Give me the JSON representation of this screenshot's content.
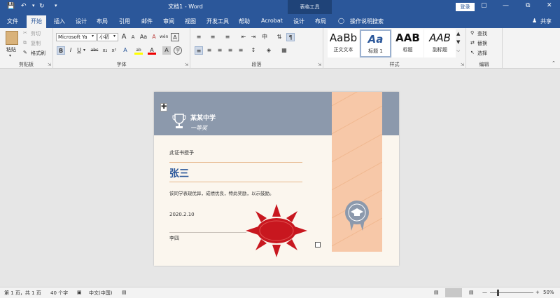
{
  "titlebar": {
    "doc_title": "文档1 - Word",
    "context_tab": "表格工具",
    "login": "登录",
    "quick_access": [
      "save-icon",
      "undo-icon",
      "redo-icon",
      "customize-icon"
    ]
  },
  "tabs": [
    "文件",
    "开始",
    "插入",
    "设计",
    "布局",
    "引用",
    "邮件",
    "审阅",
    "视图",
    "开发工具",
    "帮助",
    "Acrobat",
    "设计",
    "布局"
  ],
  "tell_me": "操作说明搜索",
  "share": "共享",
  "clipboard": {
    "paste": "粘贴",
    "cut": "剪切",
    "copy": "复制",
    "format_painter": "格式刷",
    "label": "剪贴板"
  },
  "font": {
    "name": "Microsoft Ya",
    "size": "小初",
    "label": "字体",
    "aa": "Aa",
    "grow": "A",
    "shrink": "A",
    "clear": "A",
    "wen": "wén",
    "a_box": "A",
    "bold": "B",
    "italic": "I",
    "underline": "U",
    "strike": "abc",
    "sub": "x₂",
    "sup": "x²",
    "effects": "A",
    "highlight": "ab",
    "fcolor": "A",
    "shade": "A",
    "circle": "字"
  },
  "paragraph": {
    "label": "段落"
  },
  "styles": {
    "label": "样式",
    "items": [
      {
        "preview": "AaBb",
        "name": "正文文本"
      },
      {
        "preview": "Aa",
        "name": "标题 1"
      },
      {
        "preview": "AAB",
        "name": "标题"
      },
      {
        "preview": "AAB",
        "name": "副标题"
      }
    ]
  },
  "editing": {
    "find": "查找",
    "replace": "替换",
    "select": "选择",
    "label": "编辑"
  },
  "colors": {
    "accent": "#2b579a",
    "header_band": "#8c99ac",
    "ribbon_band": "#f7c8a8",
    "seal": "#c8171f",
    "badge": "#8c99ac"
  },
  "certificate": {
    "school": "某某中学",
    "award": "一等奖",
    "intro": "此证书授予",
    "name": "张三",
    "body": "该同学表现优异，成绩优良，特此奖励，以示鼓励。",
    "date": "2020.2.10",
    "signer": "李四"
  },
  "status": {
    "page": "第 1 页，共 1 页",
    "words": "40 个字",
    "lang": "中文(中国)",
    "zoom": "50%"
  }
}
